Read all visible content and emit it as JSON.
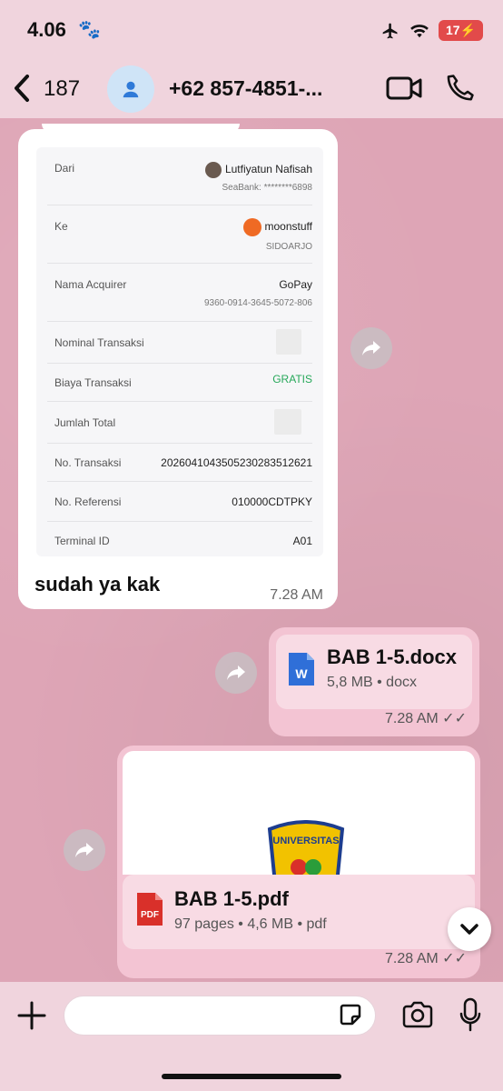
{
  "status_bar": {
    "time": "4.06",
    "battery": "17"
  },
  "header": {
    "back_count": "187",
    "contact_name": "+62 857-4851-..."
  },
  "receipt": {
    "rows": [
      {
        "label": "Dari",
        "value": "Lutfiyatun Nafisah",
        "sub": "SeaBank: ********6898"
      },
      {
        "label": "Ke",
        "value": "moonstuff",
        "sub": "SIDOARJO"
      },
      {
        "label": "Nama Acquirer",
        "value": "GoPay",
        "sub": "9360-0914-3645-5072-806"
      },
      {
        "label": "Nominal Transaksi",
        "value": ""
      },
      {
        "label": "Biaya Transaksi",
        "value": "GRATIS"
      },
      {
        "label": "Jumlah Total",
        "value": ""
      },
      {
        "label": "No. Transaksi",
        "value": "20260410435052302835126​21"
      },
      {
        "label": "No. Referensi",
        "value": "010000CDTPKY"
      },
      {
        "label": "Terminal ID",
        "value": "A01"
      }
    ]
  },
  "incoming_message": {
    "text": "sudah ya kak",
    "time": "7.28 AM"
  },
  "docx_message": {
    "title": "BAB 1-5.docx",
    "meta": "5,8 MB • docx",
    "time": "7.28 AM",
    "icon_letter": "W"
  },
  "pdf_message": {
    "title": "BAB 1-5.pdf",
    "meta": "97 pages • 4,6 MB • pdf",
    "time": "7.28 AM",
    "icon_label": "PDF",
    "preview_text": "UNIVERSITAS"
  },
  "colors": {
    "accent": "#e0a8b9",
    "bubble_out": "#f3c4d3",
    "word_blue": "#2f6fd8",
    "pdf_red": "#d9302a"
  }
}
